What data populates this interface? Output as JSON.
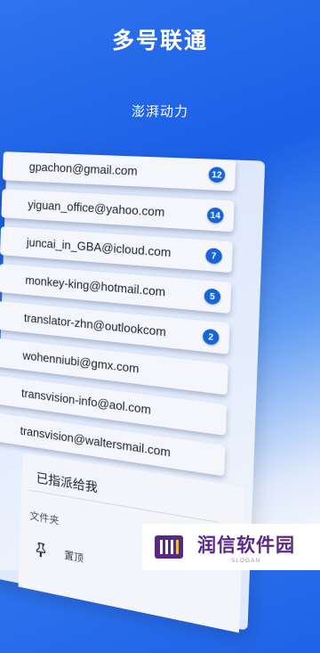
{
  "header": {
    "title": "多号联通",
    "subtitle": "澎湃动力"
  },
  "accounts": [
    {
      "email": "gpachon@gmail.com",
      "count": "12"
    },
    {
      "email": "yiguan_office@yahoo.com",
      "count": "14"
    },
    {
      "email": "juncai_in_GBA@icloud.com",
      "count": "7"
    },
    {
      "email": "monkey-king@hotmail.com",
      "count": "5"
    },
    {
      "email": "translator-zhn@outlookcom",
      "count": "2"
    },
    {
      "email": "wohenniubi@gmx.com",
      "count": ""
    },
    {
      "email": "transvision-info@aol.com",
      "count": ""
    },
    {
      "email": "transvision@waltersmail.com",
      "count": ""
    }
  ],
  "sheet": {
    "assigned_label": "已指派给我",
    "folder_label": "文件夹",
    "pin_label": "置顶"
  },
  "watermark": {
    "name": "润信软件园",
    "slogan": "SLOGAN",
    "color": "#5a2786"
  },
  "colors": {
    "accent": "#1565d8",
    "background": "#1a5fe6"
  }
}
